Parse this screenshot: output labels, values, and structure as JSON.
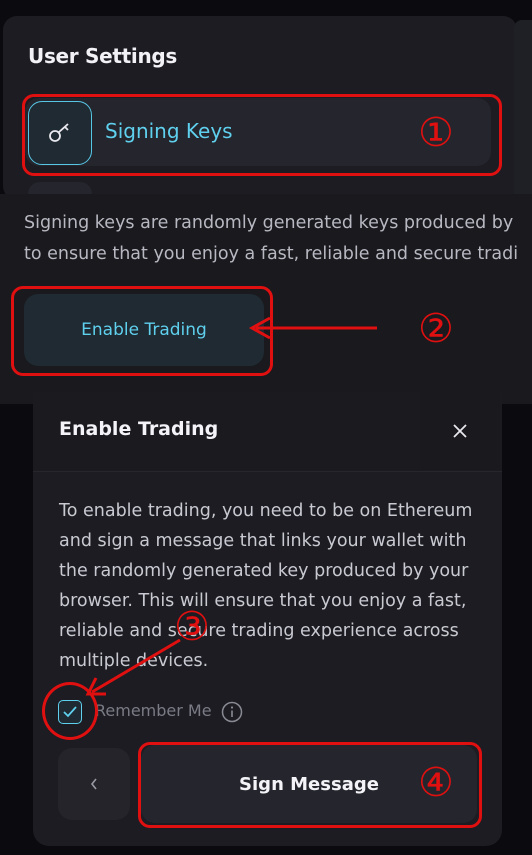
{
  "settings": {
    "title": "User Settings",
    "signing_keys_label": "Signing Keys"
  },
  "description": {
    "line1": "Signing keys are randomly generated keys produced by",
    "line2": "to ensure that you enjoy a fast, reliable and secure tradi"
  },
  "enable_button_label": "Enable Trading",
  "modal": {
    "title": "Enable Trading",
    "body": "To enable trading, you need to be on Ethereum and sign a message that links your wallet with the randomly generated key produced by your browser. This will ensure that you enjoy a fast, reliable and secure trading experience across multiple devices.",
    "remember_label": "Remember Me",
    "remember_checked": true,
    "sign_button_label": "Sign Message"
  },
  "annotations": [
    "①",
    "②",
    "③",
    "④"
  ],
  "colors": {
    "accent": "#5fd0ee",
    "annotation": "#e01010",
    "panel": "#1c1c22"
  }
}
